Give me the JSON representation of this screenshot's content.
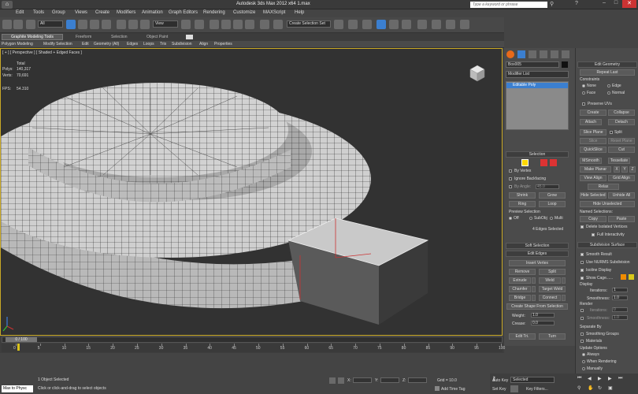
{
  "titlebar": {
    "title": "Autodesk 3ds Max 2012 x64     1.max",
    "search_placeholder": "Type a keyword or phrase"
  },
  "menu": [
    "Edit",
    "Tools",
    "Group",
    "Views",
    "Create",
    "Modifiers",
    "Animation",
    "Graph Editors",
    "Rendering",
    "Customize",
    "MAXScript",
    "Help"
  ],
  "toolbar": {
    "selection_filter": "All",
    "view_dropdown": "View",
    "selection_set": "Create Selection Set"
  },
  "ribbon": {
    "tabs": [
      "Graphite Modeling Tools",
      "Freeform",
      "Selection",
      "Object Paint"
    ],
    "items": [
      "Polygon Modeling",
      "Modify Selection",
      "Edit",
      "Geometry (All)",
      "Edges",
      "Loops",
      "Tris",
      "Subdivision",
      "Align",
      "Properties"
    ]
  },
  "viewport": {
    "label": "[ + ] [ Perspective ] [ Shaded + Edged Faces ]",
    "stats": {
      "total": "Total",
      "polys_label": "Polys:",
      "polys": "140,317",
      "verts_label": "Verts:",
      "verts": "70,691",
      "fps_label": "FPS:",
      "fps": "54.310"
    },
    "accent": "#c9a825"
  },
  "cmd": {
    "object_name": "Box005",
    "modifier_list": "Modifier List",
    "stack_item": "Editable Poly",
    "selection_title": "Selection",
    "by_vertex": "By Vertex",
    "ignore_backfacing": "Ignore Backfacing",
    "by_angle": "By Angle:",
    "by_angle_val": "45.0",
    "shrink": "Shrink",
    "grow": "Grow",
    "ring": "Ring",
    "loop": "Loop",
    "preview_label": "Preview Selection",
    "preview_off": "Off",
    "preview_subobj": "SubObj",
    "preview_multi": "Multi",
    "edges_selected": "4 Edges Selected",
    "soft_selection": "Soft Selection",
    "edit_edges": "Edit Edges",
    "insert_vertex": "Insert Vertex",
    "remove": "Remove",
    "split": "Split",
    "extrude": "Extrude",
    "weld": "Weld",
    "chamfer": "Chamfer",
    "target_weld": "Target Weld",
    "bridge": "Bridge",
    "connect": "Connect",
    "create_shape": "Create Shape From Selection",
    "weight_label": "Weight:",
    "weight": "1.0",
    "crease_label": "Crease:",
    "crease": "0.0",
    "edit_tri": "Edit Tri.",
    "turn": "Turn"
  },
  "right": {
    "edit_geometry": "Edit Geometry",
    "repeat_last": "Repeat Last",
    "constraints": "Constraints",
    "none": "None",
    "edge": "Edge",
    "face": "Face",
    "normal": "Normal",
    "preserve_uvs": "Preserve UVs",
    "create": "Create",
    "collapse": "Collapse",
    "attach": "Attach",
    "detach": "Detach",
    "slice_plane": "Slice Plane",
    "split": "Split",
    "slice": "Slice",
    "reset_plane": "Reset Plane",
    "quickslice": "QuickSlice",
    "cut": "Cut",
    "msmooth": "MSmooth",
    "tessellate": "Tessellate",
    "make_planar": "Make Planar",
    "x": "X",
    "y": "Y",
    "z": "Z",
    "view_align": "View Align",
    "grid_align": "Grid Align",
    "relax": "Relax",
    "hide_selected": "Hide Selected",
    "unhide_all": "Unhide All",
    "hide_unselected": "Hide Unselected",
    "named_selections": "Named Selections:",
    "copy": "Copy",
    "paste": "Paste",
    "delete_isolated": "Delete Isolated Vertices",
    "full_interactivity": "Full Interactivity",
    "subdivision_surface": "Subdivision Surface",
    "smooth_result": "Smooth Result",
    "use_nurms": "Use NURMS Subdivision",
    "isoline": "Isoline Display",
    "show_cage": "Show Cage......",
    "display": "Display",
    "iterations_label": "Iterations:",
    "iterations": "1",
    "smoothness_label": "Smoothness:",
    "smoothness": "1.0",
    "render": "Render",
    "r_iterations": "0",
    "r_smoothness": "1.0",
    "separate_by": "Separate By",
    "smoothing_groups": "Smoothing Groups",
    "materials": "Materials",
    "update_options": "Update Options",
    "always": "Always",
    "when_rendering": "When Rendering",
    "manually": "Manually",
    "cage_color1": "#f08c00",
    "cage_color2": "#d8c81a"
  },
  "timeline": {
    "frame": "0 / 100",
    "ticks": [
      "0",
      "5",
      "10",
      "15",
      "20",
      "25",
      "30",
      "35",
      "40",
      "45",
      "50",
      "55",
      "60",
      "65",
      "70",
      "75",
      "80",
      "85",
      "90",
      "95",
      "100"
    ]
  },
  "status": {
    "listener": "Max to Physc",
    "selected": "1 Object Selected",
    "prompt": "Click or click-and-drag to select objects",
    "x_label": "X:",
    "y_label": "Y:",
    "z_label": "Z:",
    "grid": "Grid = 10.0",
    "add_time_tag": "Add Time Tag",
    "auto_key": "Auto Key",
    "selected_dd": "Selected",
    "set_key": "Set Key",
    "key_filters": "Key Filters..."
  }
}
